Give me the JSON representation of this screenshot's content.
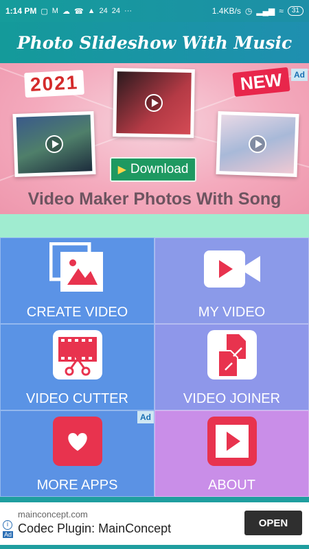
{
  "status": {
    "time": "1:14 PM",
    "icons_left": [
      "message-icon",
      "gmail-icon",
      "cloud-icon",
      "whatsapp-icon",
      "drive-icon"
    ],
    "counter1": "24",
    "counter2": "24",
    "more": "···",
    "speed": "1.4KB/s",
    "battery": "31"
  },
  "header": {
    "title": "Photo Slideshow With Music"
  },
  "banner": {
    "tag_year": "2021",
    "tag_new": "NEW",
    "ad_badge": "Ad",
    "download_label": "Download",
    "caption": "Video Maker Photos With Song"
  },
  "tiles": [
    {
      "label": "CREATE VIDEO",
      "icon": "gallery-icon",
      "color": "#5b93e6"
    },
    {
      "label": "MY VIDEO",
      "icon": "video-camera-icon",
      "color": "#8b9ae9"
    },
    {
      "label": "VIDEO CUTTER",
      "icon": "scissors-film-icon",
      "color": "#5a93e5"
    },
    {
      "label": "VIDEO JOINER",
      "icon": "file-merge-icon",
      "color": "#8e97ea"
    },
    {
      "label": "MORE APPS",
      "icon": "heart-icon",
      "color": "#5b92e4",
      "ad_badge": "Ad"
    },
    {
      "label": "ABOUT",
      "icon": "play-box-icon",
      "color": "#c98ee8"
    }
  ],
  "ad_footer": {
    "domain": "mainconcept.com",
    "title": "Codec Plugin: MainConcept",
    "button": "OPEN",
    "info": "i",
    "chip": "Ad"
  },
  "colors": {
    "teal": "#1f9e9f",
    "accent_red": "#e8334e",
    "download_green": "#1e9961"
  }
}
